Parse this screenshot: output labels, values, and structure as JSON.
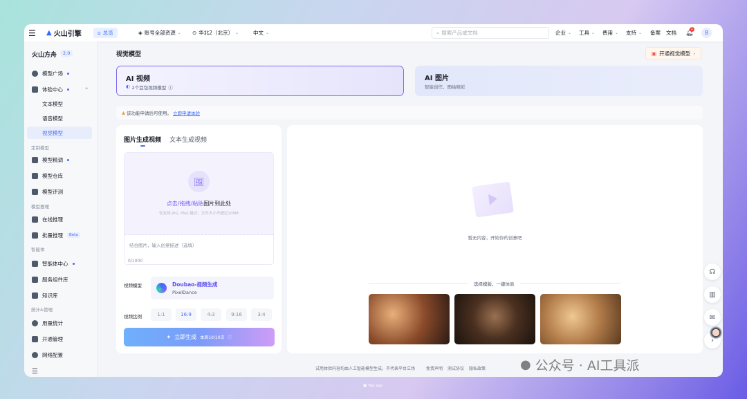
{
  "header": {
    "brand": "火山引擎",
    "overview": "总览",
    "account": "账号全部资源",
    "region": "华北2（北京）",
    "language": "中文",
    "search_placeholder": "搜索产品或文档",
    "menus": [
      "企业",
      "工具",
      "费用",
      "支持"
    ],
    "links": [
      "备案",
      "文档"
    ],
    "notification_count": "1",
    "avatar": "8"
  },
  "sidebar": {
    "product": "火山方舟",
    "version": "2.0",
    "items": [
      {
        "label": "模型广场",
        "icon": "bulb-icon",
        "dot": true
      },
      {
        "label": "体验中心",
        "icon": "experience-icon",
        "dot": true
      },
      {
        "label": "文本模型"
      },
      {
        "label": "语音模型"
      },
      {
        "label": "视觉模型",
        "active": true
      }
    ],
    "groups": [
      {
        "title": "定制模型",
        "items": [
          {
            "label": "模型精调",
            "dot": true
          },
          {
            "label": "模型仓库"
          },
          {
            "label": "模型评测"
          }
        ]
      },
      {
        "title": "模型推理",
        "items": [
          {
            "label": "在线推理"
          },
          {
            "label": "批量推理",
            "badge": "Beta"
          }
        ]
      },
      {
        "title": "智能体",
        "items": [
          {
            "label": "智能体中心",
            "dot": true
          },
          {
            "label": "服务组件库"
          },
          {
            "label": "知识库"
          }
        ]
      },
      {
        "title": "统计&管理",
        "items": [
          {
            "label": "用量统计"
          },
          {
            "label": "开通管理"
          },
          {
            "label": "网络配置"
          }
        ]
      }
    ]
  },
  "main": {
    "title": "视觉模型",
    "activate_button": "开通视觉模型",
    "cards": [
      {
        "title": "AI 视频",
        "subtitle": "2个豆包视频模型"
      },
      {
        "title": "AI 图片",
        "subtitle": "智能创作、图绘精彩"
      }
    ],
    "notice": {
      "text": "该功能申请后可使用。",
      "link": "立即申请体验"
    },
    "tabs": [
      "图片生成视频",
      "文本生成视频"
    ],
    "upload": {
      "action": "点击/拖拽/粘贴",
      "suffix": "图片到此处",
      "hint": "仅支持 JPG, PNG 格式，文件大小不超过10MB"
    },
    "prompt_placeholder": "结合图片，输入创意描述（选填）",
    "char_count": "0/1000",
    "model_label": "视频模型",
    "model_name": "Doubao-视频生成",
    "model_sub": "PixelDance",
    "ratio_label": "视频比例",
    "ratios": [
      "1:1",
      "16:9",
      "4:3",
      "9:16",
      "3:4"
    ],
    "selected_ratio": "16:9",
    "generate_button": "立即生成",
    "quota": "本周10/10次",
    "empty_text": "暂无内容，开始你的创意吧",
    "templates_title": "选择模版，一键体验"
  },
  "footer": {
    "disclaimer": "试用体验内容均由人工智能模型生成，不代表平台立场",
    "links": [
      "免责声明",
      "测试协议",
      "隐私政策"
    ]
  },
  "watermark": "公众号 · AI工具派",
  "dock_label": "Tuji app",
  "colors": {
    "accent": "#4d6bfe",
    "purple": "#7b61ff"
  }
}
